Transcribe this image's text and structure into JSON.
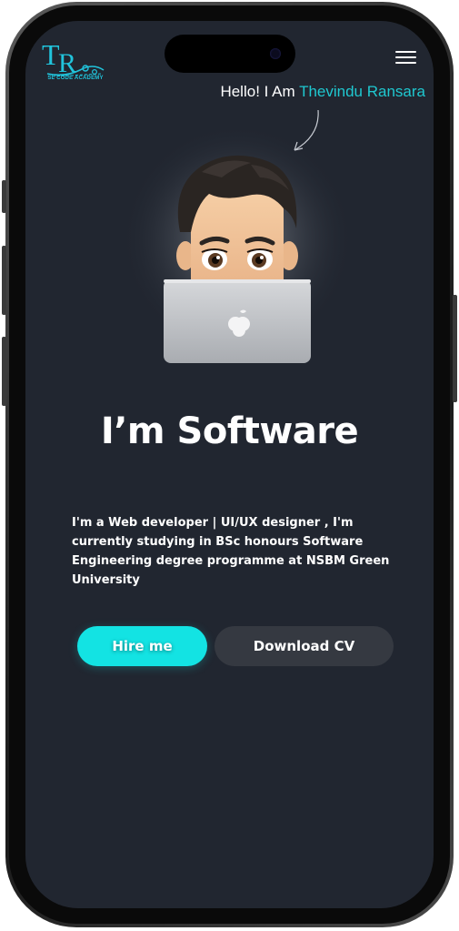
{
  "header": {
    "logo_monogram": "TR",
    "logo_caption": "SL CODE ACADEMY",
    "menu_icon": "hamburger-menu-icon"
  },
  "hero": {
    "greeting_prefix": "Hello! I Am ",
    "greeting_name": "Thevindu Ransara",
    "headline": "I’m Software",
    "bio": "I'm a Web developer | UI/UX designer , I'm currently studying in BSc honours Software Engineering degree programme at NSBM Green University",
    "avatar_icon": "memoji-laptop-avatar"
  },
  "actions": {
    "hire_label": "Hire me",
    "cv_label": "Download CV"
  },
  "colors": {
    "background": "#212630",
    "accent": "#13e3e3",
    "name_accent": "#1fc8d0",
    "secondary_button": "#353941"
  }
}
